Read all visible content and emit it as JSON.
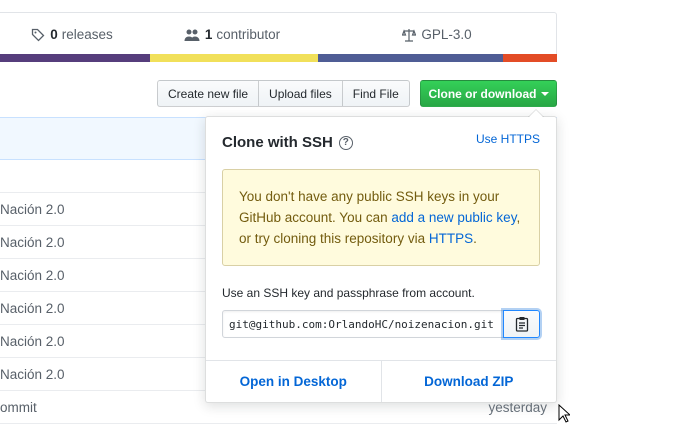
{
  "summary": {
    "releases_count": "0",
    "releases_label": "releases",
    "contributors_count": "1",
    "contributors_label": "contributor",
    "license": "GPL-3.0"
  },
  "lang_colors": [
    "#563d7c",
    "#f1e05a",
    "#4F5D95",
    "#e34c26"
  ],
  "toolbar": {
    "create_new_file": "Create new file",
    "upload_files": "Upload files",
    "find_file": "Find File",
    "clone_or_download": "Clone or download"
  },
  "files": [
    {
      "message": "Nación 2.0",
      "age": ""
    },
    {
      "message": "Nación 2.0",
      "age": ""
    },
    {
      "message": "Nación 2.0",
      "age": ""
    },
    {
      "message": "Nación 2.0",
      "age": ""
    },
    {
      "message": "Nación 2.0",
      "age": ""
    },
    {
      "message": "Nación 2.0",
      "age": ""
    },
    {
      "message": "ommit",
      "age": "yesterday"
    }
  ],
  "clone": {
    "title": "Clone with SSH",
    "use_https": "Use HTTPS",
    "flash_text_1": "You don't have any public SSH keys in your GitHub account. You can ",
    "flash_link_1": "add a new public key",
    "flash_text_2": ", or try cloning this repository via ",
    "flash_link_2": "HTTPS",
    "flash_text_3": ".",
    "ssh_label": "Use an SSH key and passphrase from account.",
    "url": "git@github.com:OrlandoHC/noizenacion.git",
    "open_in_desktop": "Open in Desktop",
    "download_zip": "Download ZIP"
  }
}
